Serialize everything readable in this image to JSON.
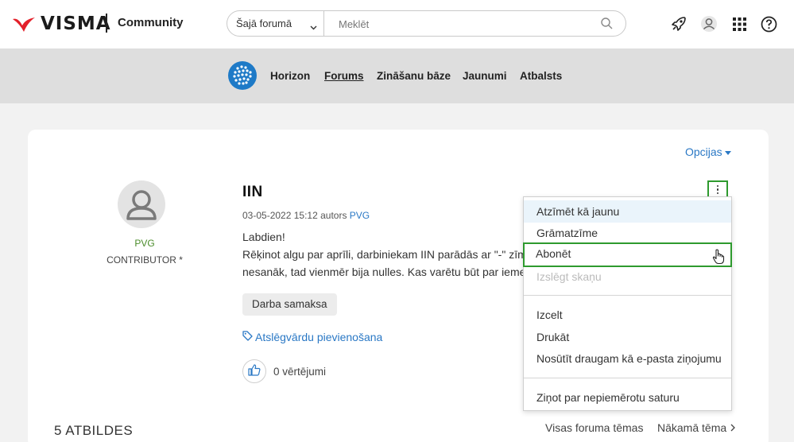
{
  "header": {
    "brand": "VISMA",
    "community_label": "Community",
    "search_scope": "Šajā forumā",
    "search_placeholder": "Meklēt",
    "icons": [
      "rocket-icon",
      "user-avatar-icon",
      "apps-grid-icon",
      "help-icon"
    ]
  },
  "nav": {
    "items": [
      "Horizon",
      "Forums",
      "Zināšanu bāze",
      "Jaunumi",
      "Atbalsts"
    ],
    "active": "Forums"
  },
  "options_label": "Opcijas",
  "author": {
    "name": "PVG",
    "role": "CONTRIBUTOR *"
  },
  "post": {
    "title": "IIN",
    "date": "03-05-2022 15:12",
    "by_label": "autors",
    "user": "PVG",
    "body_line1": "Labdien!",
    "body_line2": "Rēķinot algu par aprīli, darbiniekam IIN parādās ar \"-\" zīmi",
    "body_line3": "nesanāk, tad vienmēr bija nulles. Kas varētu būt par iemes",
    "tag": "Darba samaksa",
    "add_tags": "Atslēgvārdu pievienošana",
    "kudos": "0 vērtējumi"
  },
  "menu": {
    "items": [
      "Atzīmēt kā jaunu",
      "Grāmatzīme",
      "Abonēt",
      "Izslēgt skaņu",
      "Izcelt",
      "Drukāt",
      "Nosūtīt draugam kā e-pasta ziņojumu",
      "Ziņot par nepiemērotu saturu"
    ],
    "highlighted": "Atzīmēt kā jaunu",
    "outlined": "Abonēt",
    "disabled": "Izslēgt skaņu"
  },
  "footer": {
    "replies": "5 ATBILDES",
    "all_topics": "Visas foruma tēmas",
    "next_topic": "Nākamā tēma"
  },
  "colors": {
    "link": "#2a78c5",
    "highlight_outline": "#2e9a2e",
    "brand_red": "#e3202a",
    "author_green": "#4a8c2a"
  }
}
